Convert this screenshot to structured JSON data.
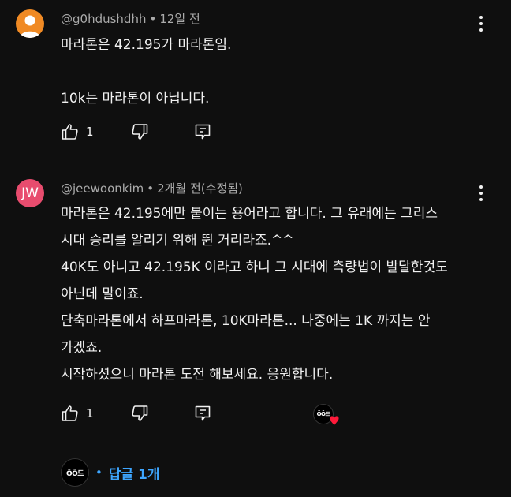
{
  "comments": [
    {
      "handle": "@g0hdushdhh",
      "time": "12일 전",
      "lines": [
        "마라톤은 42.195가 마라톤임.",
        "",
        "10k는 마라톤이 아닙니다."
      ],
      "like_count": "1"
    },
    {
      "avatar_initials": "JW",
      "handle": "@jeewoonkim",
      "time": "2개월 전(수정됨)",
      "lines": [
        "마라톤은 42.195에만 붙이는 용어라고 합니다. 그 유래에는 그리스",
        "시대 승리를 알리기 위해 뛴 거리라죠.^^",
        "40K도 아니고 42.195K 이라고 하니 그 시대에 측량법이 발달한것도",
        "아닌데 말이죠.",
        "단축마라톤에서 하프마라톤, 10K마라톤... 나중에는 1K 까지는 안",
        "가겠죠.",
        "시작하셨으니 마라톤 도전 해보세요. 응원합니다."
      ],
      "like_count": "1",
      "creator_heart": "♥"
    }
  ],
  "creator_logo_text": "ÖÖ드",
  "reply_link": {
    "label": "답글 1개"
  },
  "colors": {
    "background": "#0f0f0f",
    "accent": "#3ea6ff",
    "heart": "#ff1a3a",
    "avatar1": "#f08a24",
    "avatar2": "#e84c6e"
  },
  "icons": [
    "person-icon",
    "thumb-up-icon",
    "thumb-down-icon",
    "reply-icon",
    "more-vert-icon",
    "heart-icon"
  ]
}
